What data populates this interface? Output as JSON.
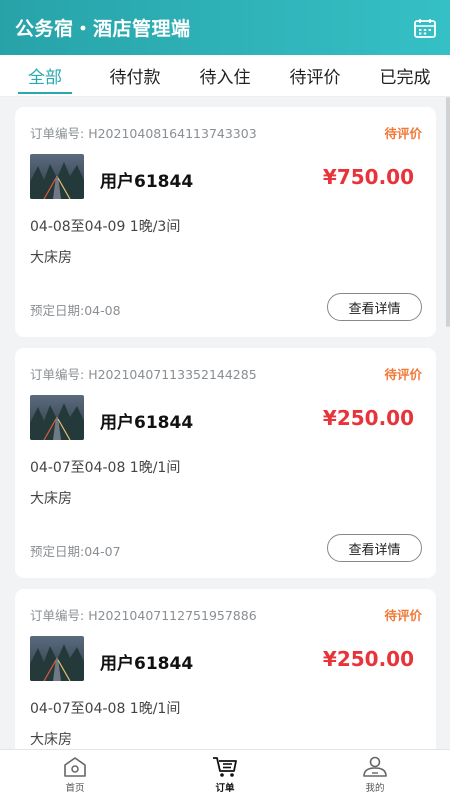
{
  "header": {
    "title": "公务宿・酒店管理端",
    "calendar_icon": "calendar-icon"
  },
  "tabs": [
    {
      "label": "全部",
      "active": true
    },
    {
      "label": "待付款",
      "active": false
    },
    {
      "label": "待入住",
      "active": false
    },
    {
      "label": "待评价",
      "active": false
    },
    {
      "label": "已完成",
      "active": false
    }
  ],
  "orders": [
    {
      "order_label": "订单编号:",
      "order_no": "H20210408164113743303",
      "status": "待评价",
      "user": "用户61844",
      "price": "¥750.00",
      "dates": "04-08至04-09 1晚/3间",
      "room": "大床房",
      "booked": "预定日期:04-08",
      "button": "查看详情"
    },
    {
      "order_label": "订单编号:",
      "order_no": "H20210407113352144285",
      "status": "待评价",
      "user": "用户61844",
      "price": "¥250.00",
      "dates": "04-07至04-08 1晚/1间",
      "room": "大床房",
      "booked": "预定日期:04-07",
      "button": "查看详情"
    },
    {
      "order_label": "订单编号:",
      "order_no": "H20210407112751957886",
      "status": "待评价",
      "user": "用户61844",
      "price": "¥250.00",
      "dates": "04-07至04-08 1晚/1间",
      "room": "大床房",
      "booked": "",
      "button": ""
    }
  ],
  "bottom_nav": [
    {
      "label": "首页",
      "icon": "home-icon",
      "active": false
    },
    {
      "label": "订单",
      "icon": "cart-icon",
      "active": true
    },
    {
      "label": "我的",
      "icon": "profile-icon",
      "active": false
    }
  ],
  "colors": {
    "accent": "#2aa9ae",
    "price": "#e8333a",
    "status": "#f07a3a"
  }
}
